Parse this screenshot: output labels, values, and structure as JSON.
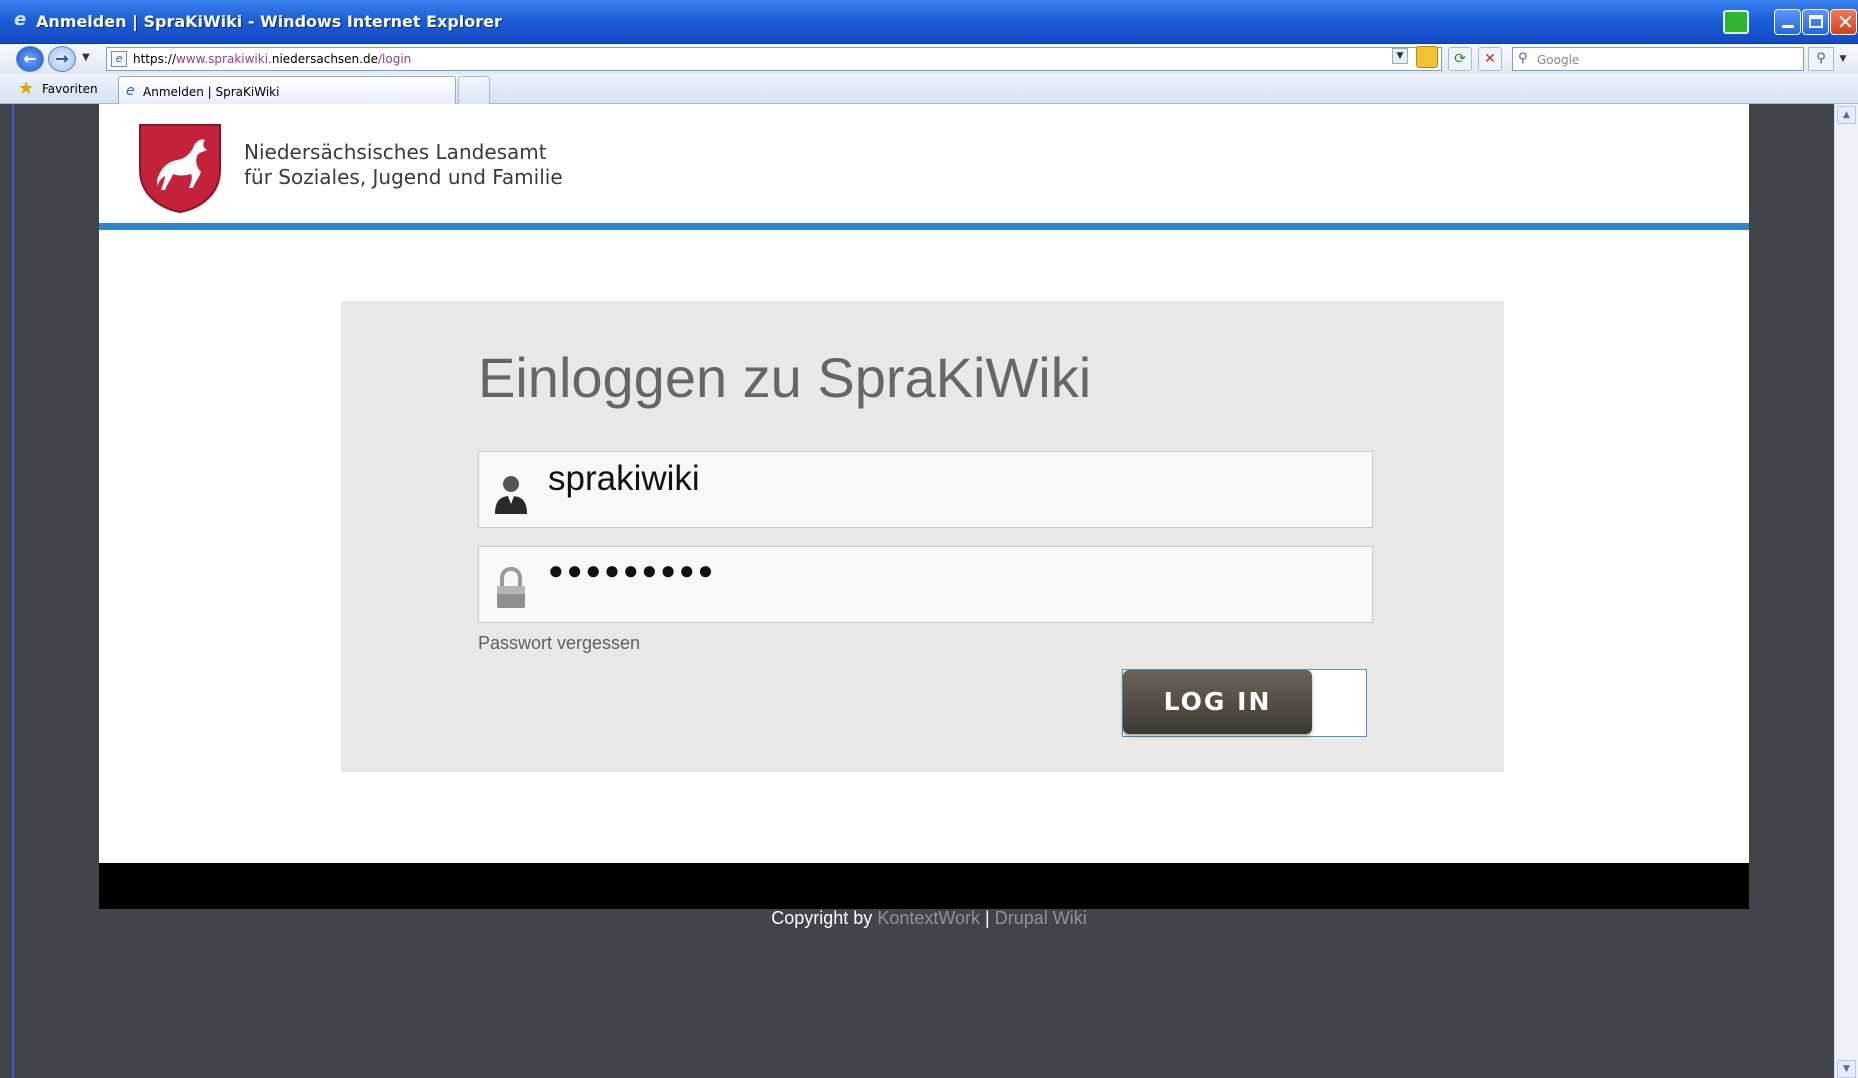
{
  "window": {
    "title": "Anmelden | SpraKiWiki - Windows Internet Explorer",
    "minimize_glyph": "",
    "close_glyph": "✕"
  },
  "nav": {
    "url_prefix": "https://",
    "url_dim1": "www.sprakiwiki.",
    "url_host": "niedersachsen.de",
    "url_path": "/login",
    "search_placeholder": "Google"
  },
  "favorites": {
    "label": "Favoriten"
  },
  "tabs": [
    {
      "label": "Anmelden | SpraKiWiki"
    }
  ],
  "header": {
    "org_line1": "Niedersächsisches Landesamt",
    "org_line2": "für Soziales, Jugend und Familie"
  },
  "login": {
    "title": "Einloggen zu SpraKiWiki",
    "username_value": "sprakiwiki",
    "password_value": "●●●●●●●●●",
    "forgot_label": "Passwort vergessen",
    "button_label": "LOG IN"
  },
  "footer": {
    "copyright_prefix": "Copyright by",
    "link1": "KontextWork",
    "separator": "|",
    "link2": "Drupal Wiki"
  },
  "colors": {
    "accent_blue": "#2f86c8",
    "login_bg": "#e9e8e4",
    "page_bg": "#41454b",
    "crest_red": "#c3223a"
  }
}
